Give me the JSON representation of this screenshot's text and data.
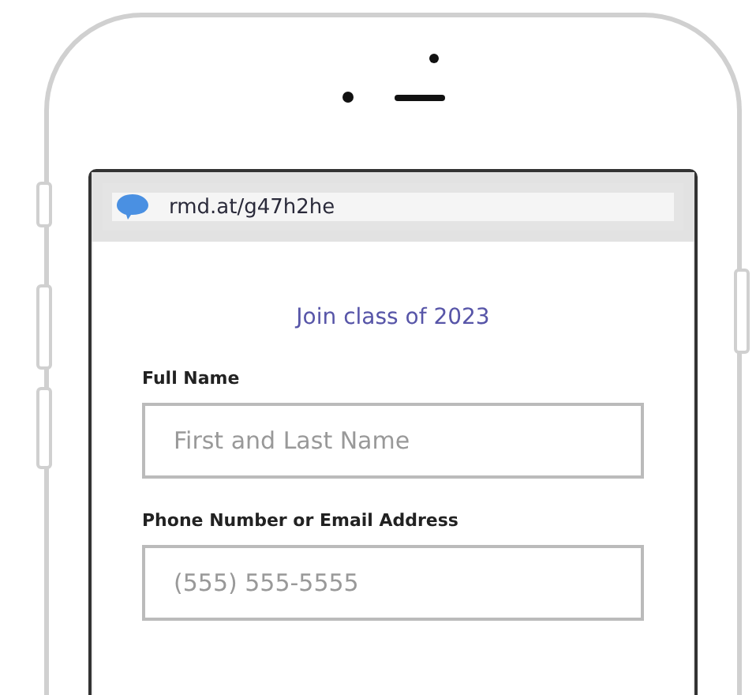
{
  "browser": {
    "url": "rmd.at/g47h2he"
  },
  "page": {
    "title": "Join class of 2023",
    "fields": [
      {
        "label": "Full Name",
        "placeholder": "First and Last Name"
      },
      {
        "label": "Phone Number or Email Address",
        "placeholder": "(555) 555-5555"
      }
    ]
  }
}
